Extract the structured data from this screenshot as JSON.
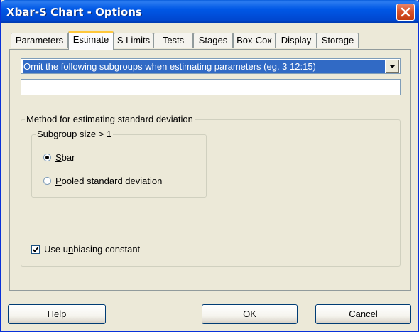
{
  "window": {
    "title": "Xbar-S Chart - Options"
  },
  "tabs": [
    {
      "label": "Parameters"
    },
    {
      "label": "Estimate"
    },
    {
      "label": "S Limits"
    },
    {
      "label": "Tests"
    },
    {
      "label": "Stages"
    },
    {
      "label": "Box-Cox"
    },
    {
      "label": "Display"
    },
    {
      "label": "Storage"
    }
  ],
  "active_tab": "Estimate",
  "estimate": {
    "omit_select_value": "Omit the following subgroups when estimating parameters (eg. 3 12:15)",
    "omit_input_value": "",
    "method_group_label": "Method for estimating standard deviation",
    "subgroup_label": "Subgroup size > 1",
    "radio_sbar": {
      "accel": "S",
      "rest": "bar",
      "checked": true
    },
    "radio_pooled": {
      "accel": "P",
      "rest": "ooled standard deviation",
      "checked": false
    },
    "unbiasing": {
      "pre": "Use u",
      "accel": "n",
      "post": "biasing constant",
      "checked": true
    }
  },
  "buttons": {
    "help": "Help",
    "ok_accel": "O",
    "ok_rest": "K",
    "cancel": "Cancel"
  },
  "colors": {
    "titlebar": "#0058e6",
    "selection": "#316ac5",
    "dialog_bg": "#ece9d8",
    "close_button": "#d8532b"
  }
}
